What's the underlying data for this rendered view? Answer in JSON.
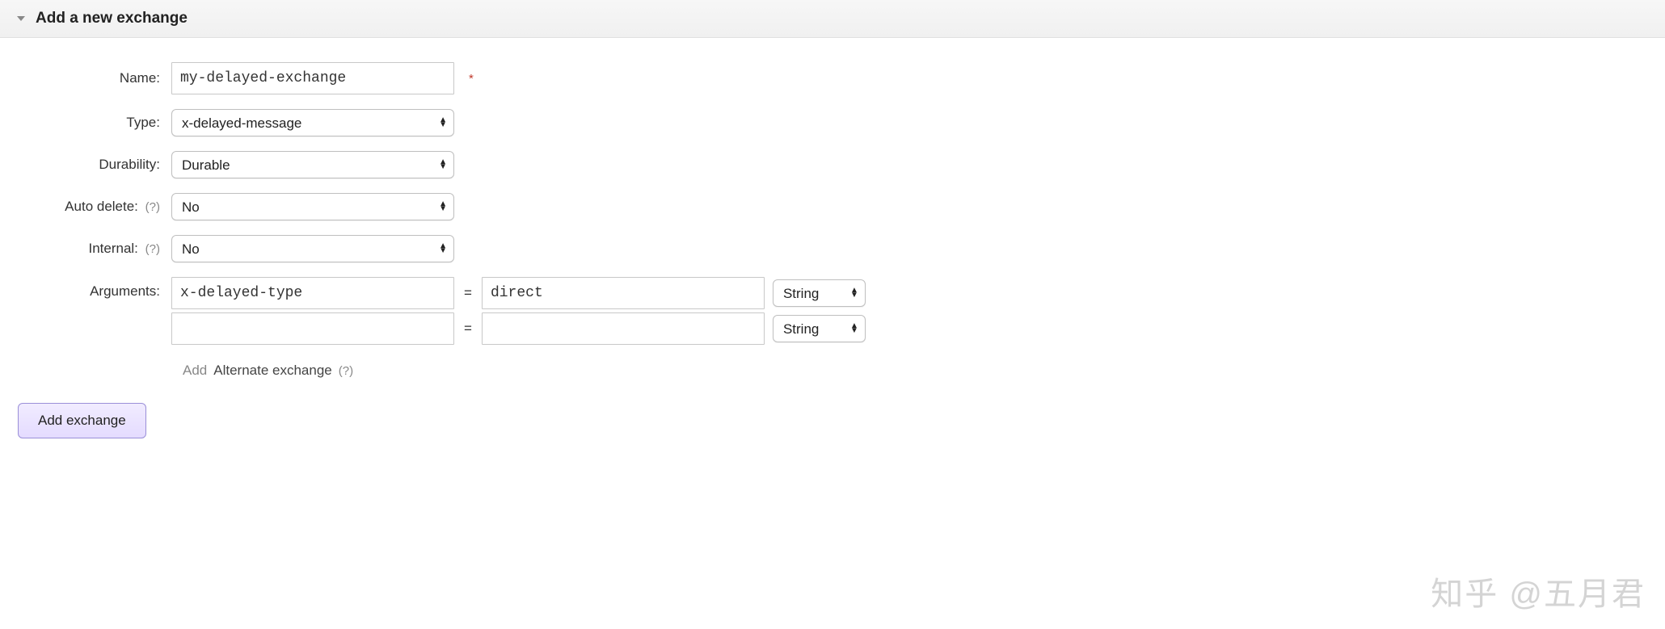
{
  "header": {
    "title": "Add a new exchange"
  },
  "form": {
    "name": {
      "label": "Name:",
      "value": "my-delayed-exchange",
      "required_mark": "*"
    },
    "type": {
      "label": "Type:",
      "value": "x-delayed-message"
    },
    "durability": {
      "label": "Durability:",
      "value": "Durable"
    },
    "auto_delete": {
      "label": "Auto delete:",
      "help": "(?)",
      "value": "No"
    },
    "internal": {
      "label": "Internal:",
      "help": "(?)",
      "value": "No"
    },
    "arguments": {
      "label": "Arguments:",
      "rows": [
        {
          "key": "x-delayed-type",
          "eq": "=",
          "val": "direct",
          "type": "String"
        },
        {
          "key": "",
          "eq": "=",
          "val": "",
          "type": "String"
        }
      ],
      "hint_add": "Add",
      "hint_text": "Alternate exchange",
      "hint_help": "(?)"
    }
  },
  "submit": {
    "label": "Add exchange"
  },
  "watermark": "知乎 @五月君"
}
